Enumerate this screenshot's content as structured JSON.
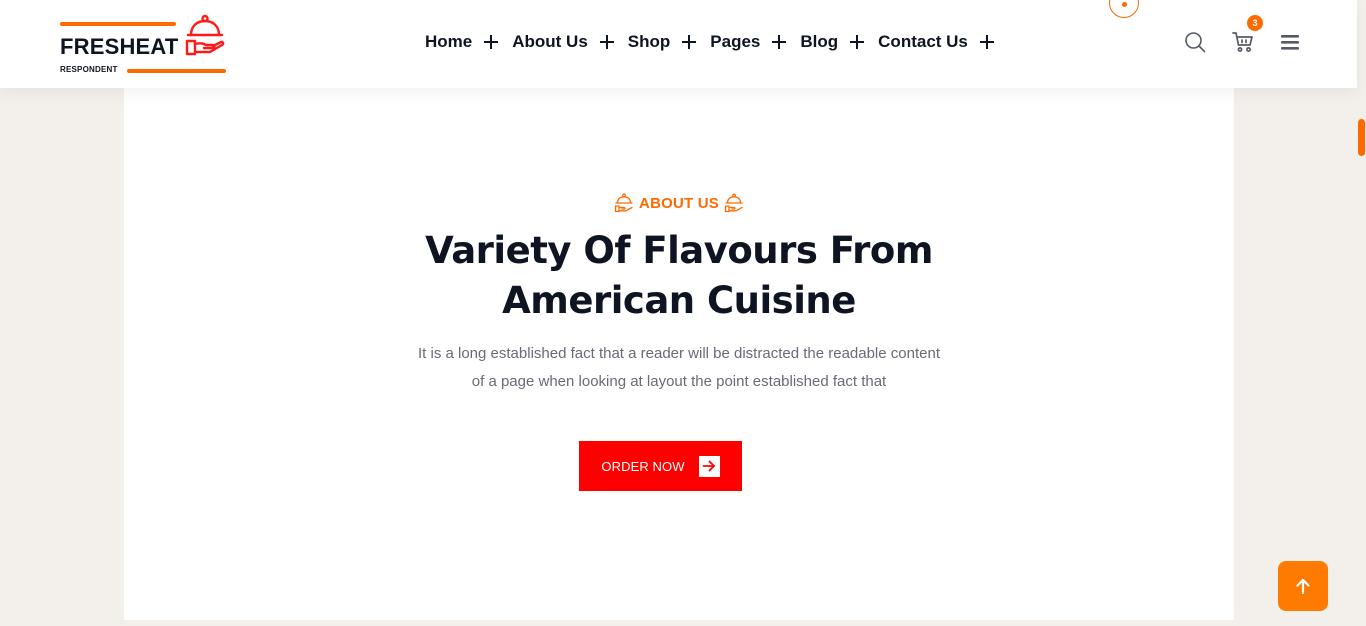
{
  "header": {
    "logo": {
      "brand": "FRESHEAT",
      "tagline": "RESPONDENT",
      "icon": "cloche-icon"
    },
    "nav": [
      {
        "label": "Home"
      },
      {
        "label": "About Us"
      },
      {
        "label": "Shop"
      },
      {
        "label": "Pages"
      },
      {
        "label": "Blog"
      },
      {
        "label": "Contact Us"
      }
    ],
    "icons": [
      "search-icon",
      "cart-icon",
      "menu-icon"
    ],
    "cart_count": "3"
  },
  "hero": {
    "eyebrow": "ABOUT US",
    "title_line1": "Variety Of Flavours From",
    "title_line2": "American Cuisine",
    "desc_line1": "It is a long established fact that a reader will be distracted the readable content",
    "desc_line2": "of a page when looking at layout the point established fact that",
    "button_label": "ORDER NOW"
  },
  "colors": {
    "accent": "#ff6a00",
    "button": "#ff0000",
    "heading": "#0e1422",
    "body_text": "#676b75",
    "page_bg": "#f3efea"
  }
}
